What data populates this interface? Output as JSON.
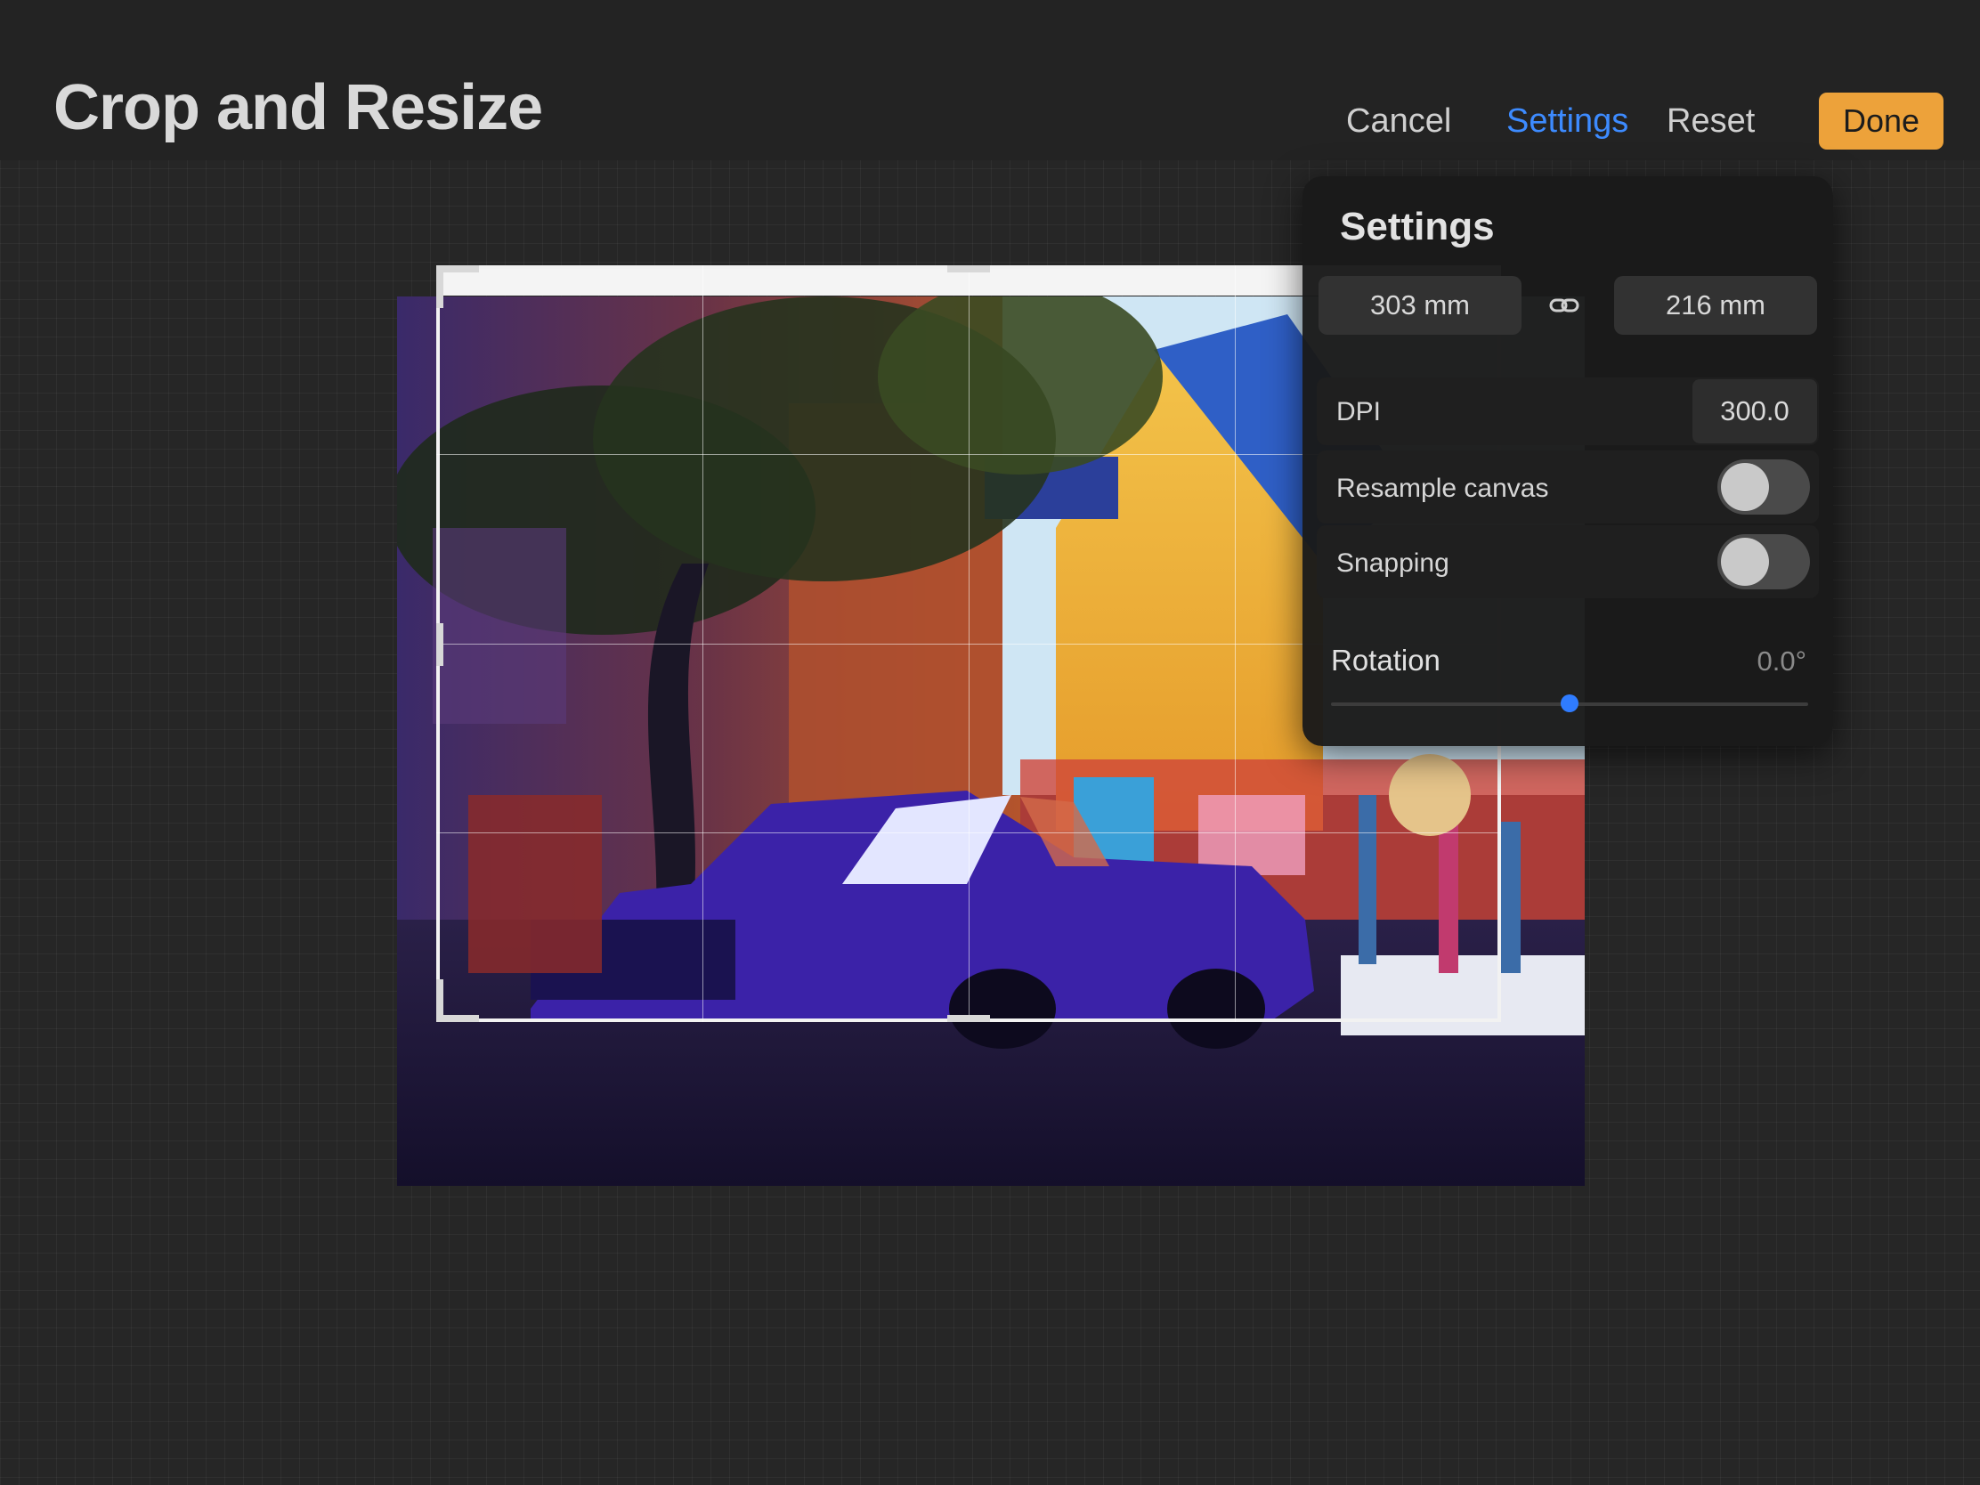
{
  "header": {
    "title": "Crop and Resize",
    "cancel_label": "Cancel",
    "settings_label": "Settings",
    "reset_label": "Reset",
    "done_label": "Done"
  },
  "settings_panel": {
    "title": "Settings",
    "width_value": "303 mm",
    "height_value": "216 mm",
    "link_icon": "chain-link-icon",
    "dpi_label": "DPI",
    "dpi_value": "300.0",
    "resample_label": "Resample canvas",
    "resample_on": false,
    "snapping_label": "Snapping",
    "snapping_on": false,
    "rotation_label": "Rotation",
    "rotation_value": "0.0°",
    "rotation_slider_fraction": 0.5
  },
  "colors": {
    "accent_blue": "#3d8bff",
    "done_orange": "#eda23a",
    "background": "#262626"
  }
}
